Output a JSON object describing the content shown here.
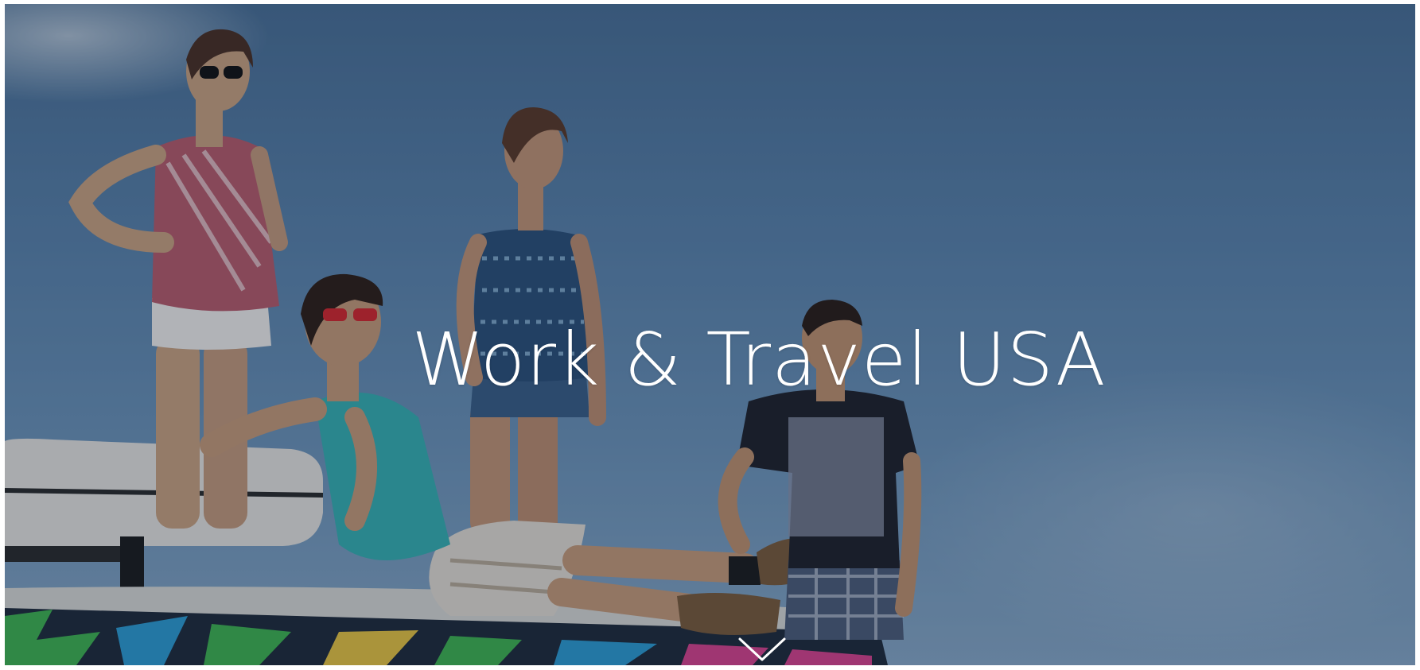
{
  "hero": {
    "title": "Work & Travel USA",
    "background": {
      "description_icon": "hero-photo",
      "sky_color": "#5a82aa"
    },
    "scroll_icon": "chevron-down-icon"
  },
  "colors": {
    "title": "#ffffff",
    "overlay": "rgba(10,25,45,0.28)"
  }
}
